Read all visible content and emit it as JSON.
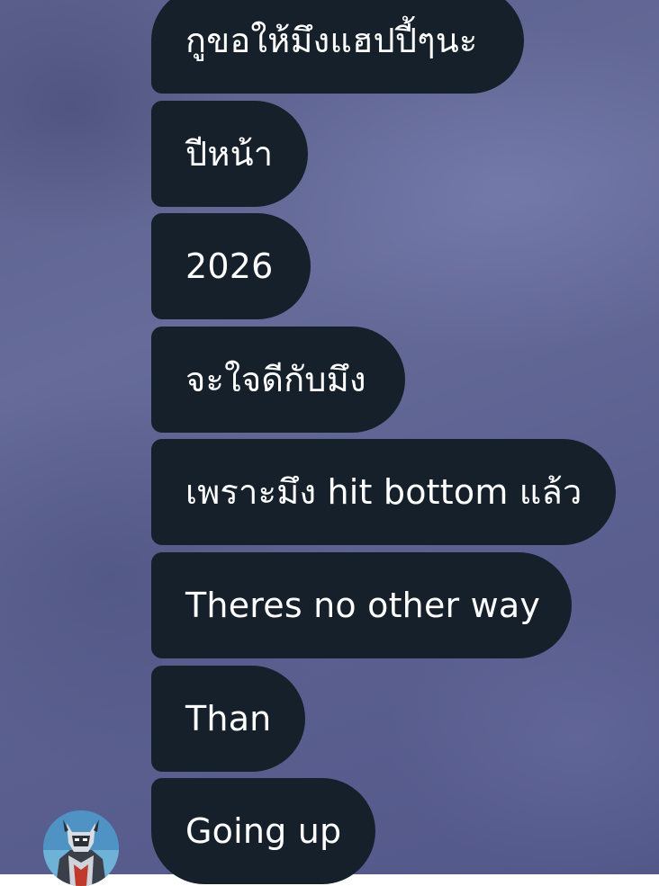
{
  "chat": {
    "messages": [
      {
        "text": "กูขอให้มึงแฮปปี้ๆนะ"
      },
      {
        "text": "ปีหน้า"
      },
      {
        "text": "2026"
      },
      {
        "text": "จะใจดีกับมึง"
      },
      {
        "text": "เพราะมึง hit bottom แล้ว"
      },
      {
        "text": "Theres no other way"
      },
      {
        "text": "Than"
      },
      {
        "text": "Going up"
      }
    ],
    "sender_avatar_icon": "armored-hero-cartoon-avatar"
  },
  "colors": {
    "bubble": "#15202b",
    "bubble_text": "#ffffff",
    "background": "#5f6492",
    "avatar_bg": "#4f93c4"
  }
}
